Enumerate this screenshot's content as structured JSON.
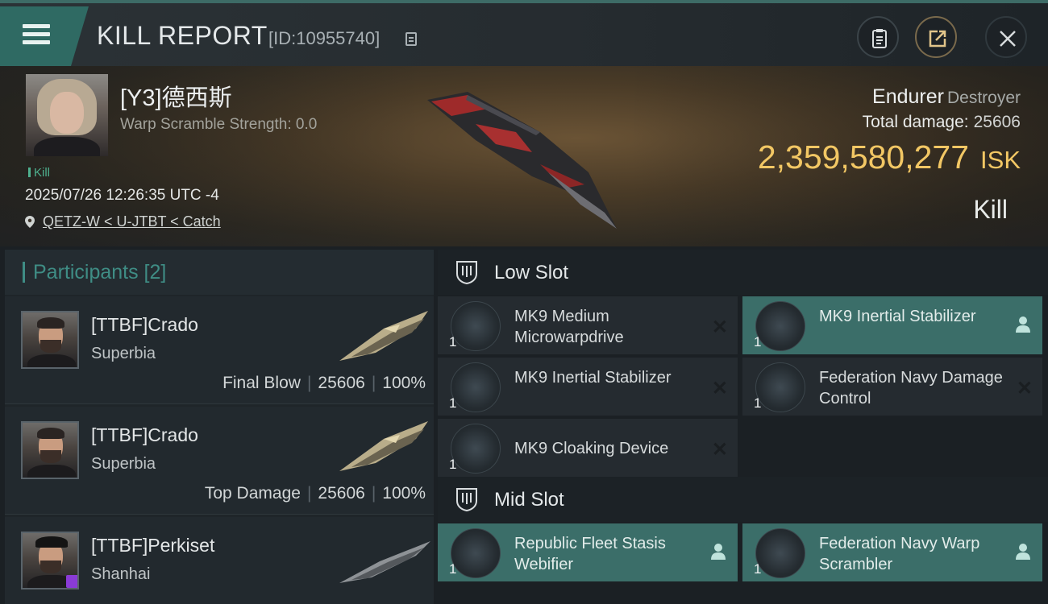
{
  "header": {
    "title": "KILL REPORT",
    "kill_id": "[ID:10955740]"
  },
  "victim": {
    "name": "[Y3]德西斯",
    "warp_scramble": "Warp Scramble Strength: 0.0",
    "tag": "Kill",
    "datetime": "2025/07/26 12:26:35 UTC -4",
    "location": "QETZ-W < U-JTBT < Catch",
    "ship_name": "Endurer",
    "ship_class": "Destroyer",
    "total_damage_label": "Total damage:",
    "total_damage": "25606",
    "isk_value": "2,359,580,277",
    "isk_unit": "ISK",
    "result": "Kill"
  },
  "participants": {
    "title": "Participants [2]",
    "items": [
      {
        "name": "[TTBF]Crado",
        "ship": "Superbia",
        "role": "Final Blow",
        "damage": "25606",
        "percent": "100%"
      },
      {
        "name": "[TTBF]Crado",
        "ship": "Superbia",
        "role": "Top Damage",
        "damage": "25606",
        "percent": "100%"
      },
      {
        "name": "[TTBF]Perkiset",
        "ship": "Shanhai",
        "role": "",
        "damage": "",
        "percent": ""
      }
    ]
  },
  "low_slot": {
    "title": "Low Slot",
    "modules": [
      {
        "qty": "1",
        "name": "MK9 Medium Microwarpdrive",
        "state": "destroyed"
      },
      {
        "qty": "1",
        "name": "MK9 Inertial Stabilizer",
        "state": "dropped"
      },
      {
        "qty": "1",
        "name": "MK9 Inertial Stabilizer",
        "state": "destroyed"
      },
      {
        "qty": "1",
        "name": "Federation Navy Damage Control",
        "state": "destroyed"
      },
      {
        "qty": "1",
        "name": "MK9 Cloaking Device",
        "state": "destroyed"
      }
    ]
  },
  "mid_slot": {
    "title": "Mid Slot",
    "modules": [
      {
        "qty": "1",
        "name": "Republic Fleet Stasis Webifier",
        "state": "dropped"
      },
      {
        "qty": "1",
        "name": "Federation Navy Warp Scrambler",
        "state": "dropped"
      }
    ]
  },
  "colors": {
    "accent": "#3f8d85",
    "isk": "#f2c764",
    "dropped": "#3b6e69"
  }
}
